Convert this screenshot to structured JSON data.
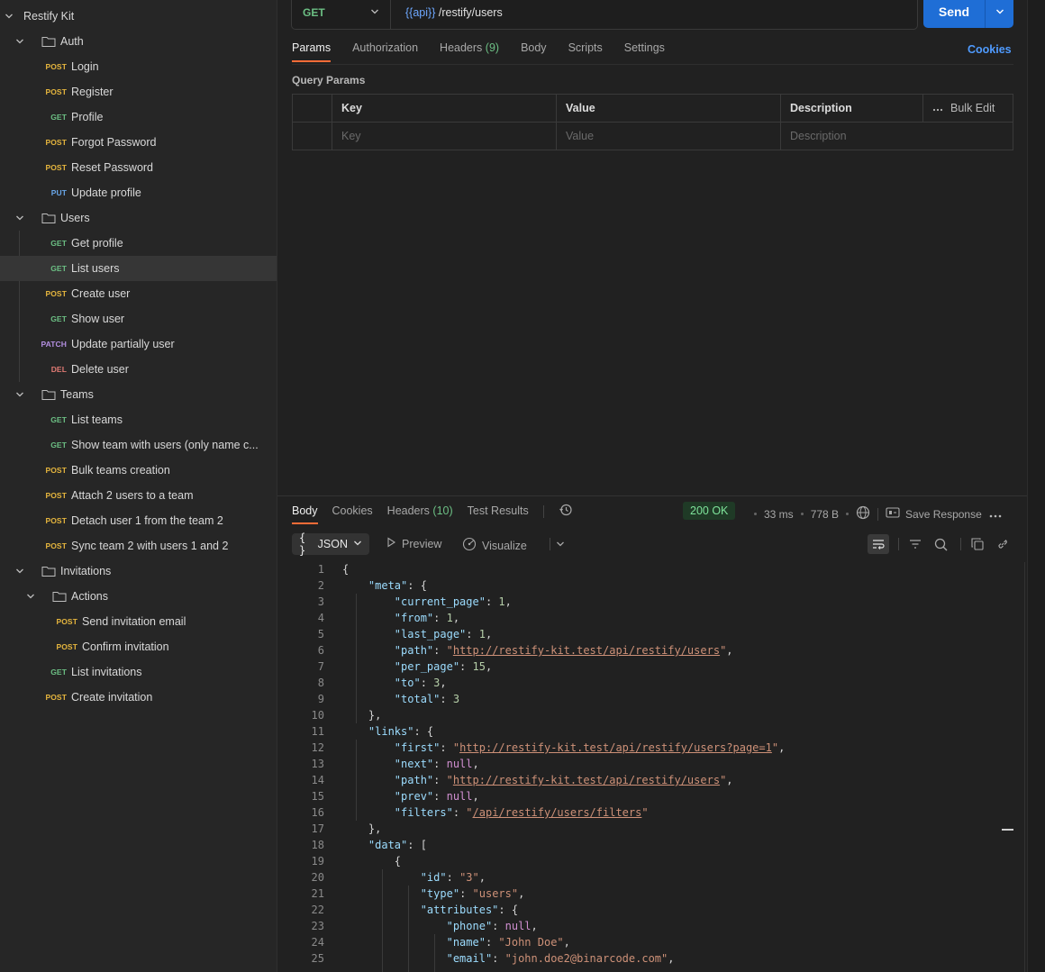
{
  "sidebar": {
    "collection": "Restify Kit",
    "auth": {
      "name": "Auth",
      "items": [
        {
          "method": "POST",
          "label": "Login"
        },
        {
          "method": "POST",
          "label": "Register"
        },
        {
          "method": "GET",
          "label": "Profile"
        },
        {
          "method": "POST",
          "label": "Forgot Password"
        },
        {
          "method": "POST",
          "label": "Reset Password"
        },
        {
          "method": "PUT",
          "label": "Update profile"
        }
      ]
    },
    "users": {
      "name": "Users",
      "items": [
        {
          "method": "GET",
          "label": "Get profile"
        },
        {
          "method": "GET",
          "label": "List users"
        },
        {
          "method": "POST",
          "label": "Create user"
        },
        {
          "method": "GET",
          "label": "Show user"
        },
        {
          "method": "PATCH",
          "label": "Update partially user"
        },
        {
          "method": "DEL",
          "label": "Delete user"
        }
      ]
    },
    "teams": {
      "name": "Teams",
      "items": [
        {
          "method": "GET",
          "label": "List teams"
        },
        {
          "method": "GET",
          "label": "Show team with users (only name c..."
        },
        {
          "method": "POST",
          "label": "Bulk teams creation"
        },
        {
          "method": "POST",
          "label": "Attach 2 users to a team"
        },
        {
          "method": "POST",
          "label": "Detach user 1 from the team 2"
        },
        {
          "method": "POST",
          "label": "Sync team 2 with users 1 and 2"
        }
      ]
    },
    "invitations": {
      "name": "Invitations",
      "actions": {
        "name": "Actions",
        "items": [
          {
            "method": "POST",
            "label": "Send invitation email"
          },
          {
            "method": "POST",
            "label": "Confirm invitation"
          }
        ]
      },
      "items": [
        {
          "method": "GET",
          "label": "List invitations"
        },
        {
          "method": "POST",
          "label": "Create invitation"
        }
      ]
    }
  },
  "request": {
    "method": "GET",
    "url_var": "{{api}}",
    "url_path": " /restify/users",
    "send_label": "Send",
    "tabs": {
      "params": "Params",
      "authorization": "Authorization",
      "headers": "Headers",
      "headers_count": "(9)",
      "body": "Body",
      "scripts": "Scripts",
      "settings": "Settings"
    },
    "cookies_label": "Cookies",
    "query_params_title": "Query Params",
    "table": {
      "key_header": "Key",
      "value_header": "Value",
      "description_header": "Description",
      "bulk_edit": "Bulk Edit",
      "key_placeholder": "Key",
      "value_placeholder": "Value",
      "description_placeholder": "Description"
    }
  },
  "response": {
    "tabs": {
      "body": "Body",
      "cookies": "Cookies",
      "headers": "Headers",
      "headers_count": "(10)",
      "test_results": "Test Results"
    },
    "status": "200 OK",
    "time": "33 ms",
    "size": "778 B",
    "save_response": "Save Response",
    "format": "JSON",
    "preview": "Preview",
    "visualize": "Visualize",
    "lines": [
      "<span class=\"p\">{</span>",
      "    <span class=\"k\">\"meta\"</span>: {",
      "        <span class=\"k\">\"current_page\"</span>: <span class=\"n\">1</span>,",
      "        <span class=\"k\">\"from\"</span>: <span class=\"n\">1</span>,",
      "        <span class=\"k\">\"last_page\"</span>: <span class=\"n\">1</span>,",
      "        <span class=\"k\">\"path\"</span>: <span class=\"s\">\"</span><span class=\"u\">http://restify-kit.test/api/restify/users</span><span class=\"s\">\"</span>,",
      "        <span class=\"k\">\"per_page\"</span>: <span class=\"n\">15</span>,",
      "        <span class=\"k\">\"to\"</span>: <span class=\"n\">3</span>,",
      "        <span class=\"k\">\"total\"</span>: <span class=\"n\">3</span>",
      "    },",
      "    <span class=\"k\">\"links\"</span>: {",
      "        <span class=\"k\">\"first\"</span>: <span class=\"s\">\"</span><span class=\"u\">http://restify-kit.test/api/restify/users?page=1</span><span class=\"s\">\"</span>,",
      "        <span class=\"k\">\"next\"</span>: <span class=\"nl\">null</span>,",
      "        <span class=\"k\">\"path\"</span>: <span class=\"s\">\"</span><span class=\"u\">http://restify-kit.test/api/restify/users</span><span class=\"s\">\"</span>,",
      "        <span class=\"k\">\"prev\"</span>: <span class=\"nl\">null</span>,",
      "        <span class=\"k\">\"filters\"</span>: <span class=\"s\">\"</span><span class=\"u\">/api/restify/users/filters</span><span class=\"s\">\"</span>",
      "    },",
      "    <span class=\"k\">\"data\"</span>: [",
      "        {",
      "            <span class=\"k\">\"id\"</span>: <span class=\"s\">\"3\"</span>,",
      "            <span class=\"k\">\"type\"</span>: <span class=\"s\">\"users\"</span>,",
      "            <span class=\"k\">\"attributes\"</span>: {",
      "                <span class=\"k\">\"phone\"</span>: <span class=\"nl\">null</span>,",
      "                <span class=\"k\">\"name\"</span>: <span class=\"s\">\"John Doe\"</span>,",
      "                <span class=\"k\">\"email\"</span>: <span class=\"s\">\"john.doe2@binarcode.com\"</span>,"
    ]
  },
  "colors": {
    "accent": "#ff6c37",
    "send": "#1f6ed6",
    "post": "#e6b63e",
    "get": "#6cbf84",
    "put": "#69a6e8",
    "patch": "#b38fe0",
    "delete": "#e27b74"
  },
  "icons": [
    "chevron-down-icon",
    "folder-icon",
    "history-icon",
    "globe-icon",
    "save-icon",
    "more-icon",
    "play-icon",
    "visualize-icon",
    "wrap-icon",
    "filter-icon",
    "search-icon",
    "copy-icon",
    "link-icon"
  ]
}
